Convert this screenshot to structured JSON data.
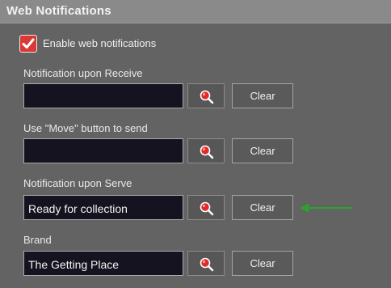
{
  "header": {
    "title": "Web Notifications"
  },
  "enable": {
    "label": "Enable web notifications",
    "checked": true,
    "accent_color": "#d93a34"
  },
  "fields": [
    {
      "label": "Notification upon Receive",
      "value": "",
      "search_icon": "search-icon",
      "clear_label": "Clear"
    },
    {
      "label": "Use \"Move\" button to send",
      "value": "",
      "search_icon": "search-icon",
      "clear_label": "Clear"
    },
    {
      "label": "Notification upon Serve",
      "value": "Ready for collection",
      "search_icon": "search-icon",
      "clear_label": "Clear"
    },
    {
      "label": "Brand",
      "value": "The Getting Place",
      "search_icon": "search-icon",
      "clear_label": "Clear"
    }
  ],
  "annotation": {
    "icon": "arrow-left-icon",
    "color": "#2aa52a"
  }
}
